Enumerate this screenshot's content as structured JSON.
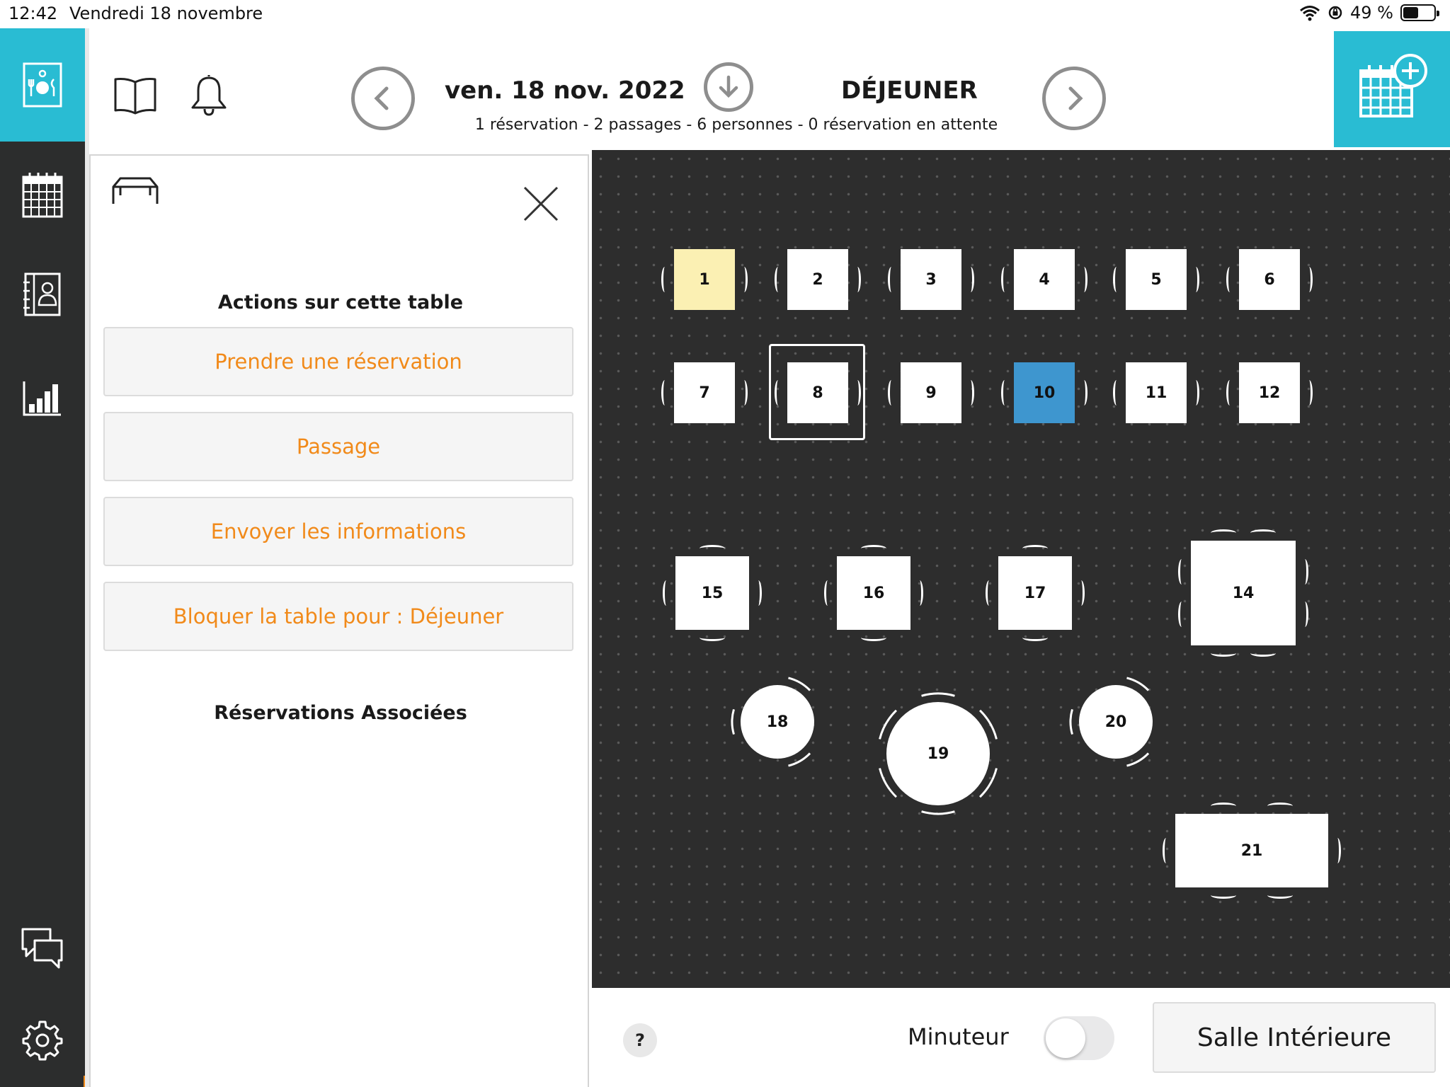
{
  "status_bar": {
    "time": "12:42",
    "date": "Vendredi 18 novembre",
    "battery_text": "49 %",
    "battery_level": 0.49
  },
  "sidebar": {
    "items": [
      {
        "name": "reservations-icon"
      },
      {
        "name": "calendar-icon"
      },
      {
        "name": "contacts-book-icon"
      },
      {
        "name": "statistics-icon"
      },
      {
        "name": "chat-icon"
      },
      {
        "name": "settings-gear-icon"
      }
    ]
  },
  "header": {
    "date": "ven. 18 nov. 2022",
    "service": "DÉJEUNER",
    "summary": "1 réservation - 2 passages - 6 personnes - 0 réservation en attente"
  },
  "panel": {
    "title": "Actions sur cette table",
    "actions": [
      {
        "label": "Prendre une réservation"
      },
      {
        "label": "Passage"
      },
      {
        "label": "Envoyer les informations"
      },
      {
        "label": "Bloquer la table pour : Déjeuner"
      }
    ],
    "associated_title": "Réservations Associées"
  },
  "floor_plan": {
    "selected_table": "8",
    "tables": [
      {
        "label": "1",
        "status": "reserved",
        "color": "#fbf0b3"
      },
      {
        "label": "2",
        "status": "free",
        "color": "#ffffff"
      },
      {
        "label": "3",
        "status": "free",
        "color": "#ffffff"
      },
      {
        "label": "4",
        "status": "free",
        "color": "#ffffff"
      },
      {
        "label": "5",
        "status": "free",
        "color": "#ffffff"
      },
      {
        "label": "6",
        "status": "free",
        "color": "#ffffff"
      },
      {
        "label": "7",
        "status": "free",
        "color": "#ffffff"
      },
      {
        "label": "8",
        "status": "selected",
        "color": "#ffffff"
      },
      {
        "label": "9",
        "status": "free",
        "color": "#ffffff"
      },
      {
        "label": "10",
        "status": "occupied",
        "color": "#3e96cf"
      },
      {
        "label": "11",
        "status": "free",
        "color": "#ffffff"
      },
      {
        "label": "12",
        "status": "free",
        "color": "#ffffff"
      },
      {
        "label": "15",
        "status": "free",
        "color": "#ffffff"
      },
      {
        "label": "16",
        "status": "free",
        "color": "#ffffff"
      },
      {
        "label": "17",
        "status": "free",
        "color": "#ffffff"
      },
      {
        "label": "14",
        "status": "free",
        "color": "#ffffff"
      },
      {
        "label": "18",
        "status": "free",
        "color": "#ffffff"
      },
      {
        "label": "19",
        "status": "free",
        "color": "#ffffff"
      },
      {
        "label": "20",
        "status": "free",
        "color": "#ffffff"
      },
      {
        "label": "21",
        "status": "free",
        "color": "#ffffff"
      }
    ]
  },
  "bottom_bar": {
    "help_label": "?",
    "timer_label": "Minuteur",
    "timer_on": false,
    "room_label": "Salle Intérieure"
  },
  "colors": {
    "accent": "#29bcd3",
    "action_text": "#f18a1a",
    "sidebar_bg": "#2c2d2d",
    "floor_bg": "#2d2d2d"
  }
}
